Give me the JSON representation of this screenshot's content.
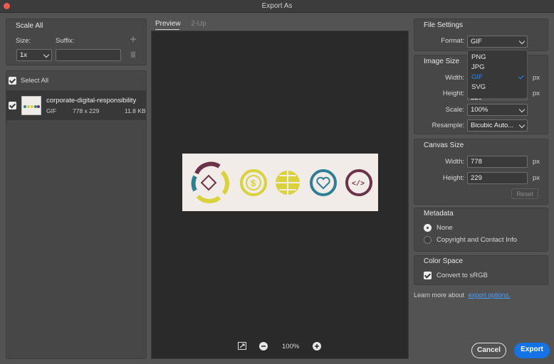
{
  "window": {
    "title": "Export As"
  },
  "scale_all": {
    "title": "Scale All",
    "size_label": "Size:",
    "suffix_label": "Suffix:",
    "size_value": "1x",
    "suffix_value": "",
    "add_icon": "plus-icon",
    "delete_icon": "trash-icon"
  },
  "assets": {
    "select_all_label": "Select All",
    "items": [
      {
        "name": "corporate-digital-responsibility",
        "format": "GIF",
        "dimensions": "778 x 229",
        "size": "11.8 KB"
      }
    ]
  },
  "preview": {
    "tabs": [
      "Preview",
      "2-Up"
    ],
    "zoom": "100%",
    "icons": [
      "fit-screen-icon",
      "zoom-out-icon",
      "zoom-in-icon"
    ]
  },
  "file_settings": {
    "title": "File Settings",
    "format_label": "Format:",
    "format_value": "GIF",
    "format_options": [
      "PNG",
      "JPG",
      "GIF",
      "SVG"
    ]
  },
  "image_size": {
    "title": "Image Size",
    "width_label": "Width:",
    "height_label": "Height:",
    "height_value": "229",
    "scale_label": "Scale:",
    "scale_value": "100%",
    "resample_label": "Resample:",
    "resample_value": "Bicubic Auto...",
    "unit": "px"
  },
  "canvas_size": {
    "title": "Canvas Size",
    "width_label": "Width:",
    "width_value": "778",
    "height_label": "Height:",
    "height_value": "229",
    "unit": "px",
    "reset_label": "Reset"
  },
  "metadata": {
    "title": "Metadata",
    "options": [
      "None",
      "Copyright and Contact Info"
    ],
    "selected": "None"
  },
  "color_space": {
    "title": "Color Space",
    "convert_label": "Convert to sRGB"
  },
  "footer": {
    "learn_more": "Learn more about",
    "link": "export options.",
    "cancel": "Cancel",
    "export": "Export"
  },
  "colors": {
    "accent": "#1473e6",
    "link": "#4a9eff"
  }
}
